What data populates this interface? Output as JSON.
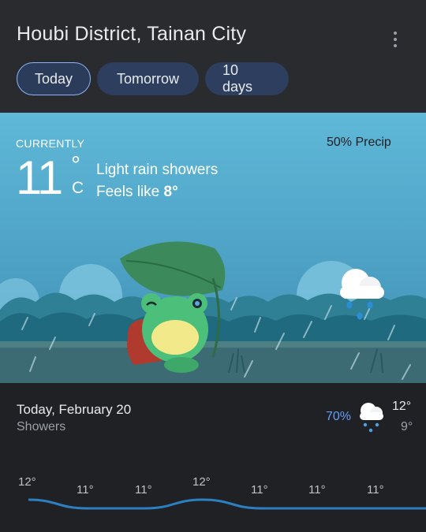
{
  "header": {
    "location": "Houbi District, Tainan City",
    "tabs": [
      {
        "label": "Today",
        "active": true
      },
      {
        "label": "Tomorrow",
        "active": false
      },
      {
        "label": "10 days",
        "active": false
      }
    ]
  },
  "current": {
    "label": "CURRENTLY",
    "temperature": "11",
    "degree_symbol": "°",
    "unit": "C",
    "condition": "Light rain showers",
    "feels_like_prefix": "Feels like",
    "feels_like_value": "8°",
    "precip": "50% Precip",
    "icon": "cloud-rain-icon"
  },
  "today": {
    "title": "Today, February 20",
    "summary": "Showers",
    "precip": "70%",
    "icon": "cloud-rain-icon",
    "high": "12°",
    "low": "9°"
  },
  "hourly": {
    "temps": [
      "12°",
      "11°",
      "11°",
      "12°",
      "11°",
      "11°",
      "11°"
    ],
    "values": [
      12,
      11,
      11,
      12,
      11,
      11,
      11
    ]
  },
  "colors": {
    "accent": "#8ab4f8",
    "precip_blue": "#669df6",
    "sky": "#5fb5d6",
    "trend_line": "#2c7fc0"
  }
}
